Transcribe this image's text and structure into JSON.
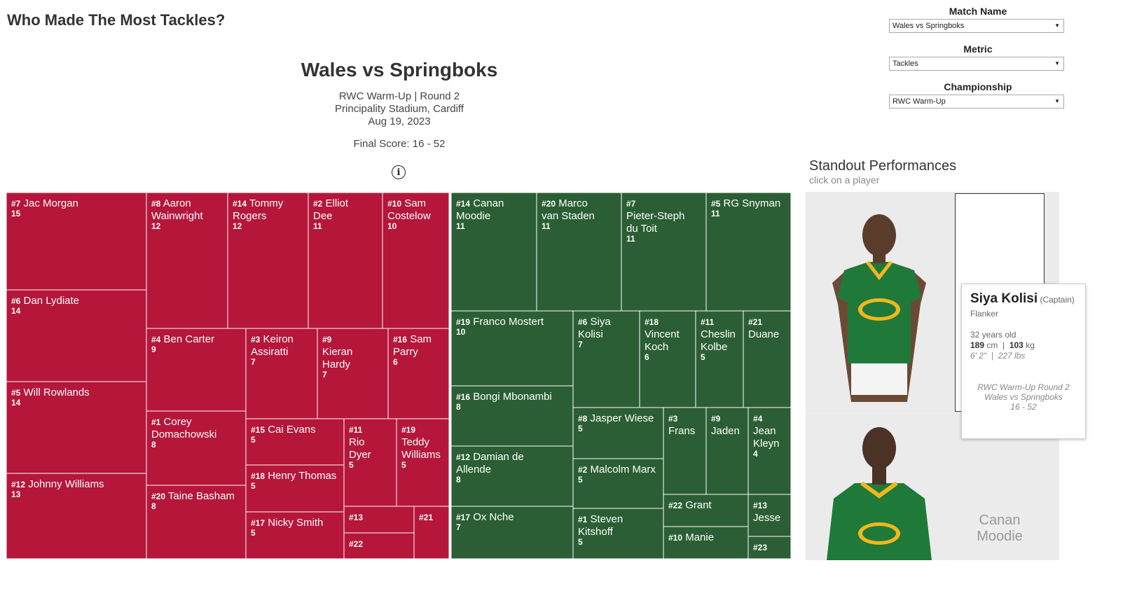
{
  "page": {
    "title": "Who Made The Most Tackles?"
  },
  "match": {
    "title": "Wales vs Springboks",
    "subtitle": "RWC Warm-Up | Round 2",
    "venue": "Principality Stadium, Cardiff",
    "date": "Aug 19, 2023",
    "final_score": "Final Score: 16 - 52",
    "info_glyph": "i"
  },
  "filters": {
    "match_name": {
      "label": "Match Name",
      "value": "Wales vs Springboks"
    },
    "metric": {
      "label": "Metric",
      "value": "Tackles"
    },
    "championship": {
      "label": "Championship",
      "value": "RWC Warm-Up"
    }
  },
  "standout": {
    "title": "Standout Performances",
    "subtitle": "click on a player",
    "second_name": "Canan Moodie"
  },
  "tooltip": {
    "name": "Siya Kolisi",
    "role": "(Captain)",
    "position": "Flanker",
    "age": "32 years old",
    "height_cm": "189",
    "weight_kg": "103",
    "height_imp": "6' 2\"",
    "weight_lbs": "227 lbs",
    "match_line1": "RWC Warm-Up Round 2",
    "match_line2": "Wales vs Springboks",
    "match_line3": "16 - 52"
  },
  "colors": {
    "wales": "#b5163a",
    "springboks": "#2b5e34",
    "tile_border": "#ffffff",
    "jersey_green": "#1f7a3a",
    "jersey_gold": "#f2b71d"
  },
  "icons": {
    "dropdown": "chevron-down-icon",
    "info": "info-icon"
  },
  "chart_data": {
    "type": "treemap",
    "metric": "Tackles",
    "teams": [
      {
        "name": "Wales",
        "players": [
          {
            "number": "#7",
            "name": "Jac Morgan",
            "value": 15
          },
          {
            "number": "#6",
            "name": "Dan Lydiate",
            "value": 14
          },
          {
            "number": "#5",
            "name": "Will Rowlands",
            "value": 14
          },
          {
            "number": "#12",
            "name": "Johnny Williams",
            "value": 13
          },
          {
            "number": "#8",
            "name": "Aaron Wainwright",
            "value": 12
          },
          {
            "number": "#14",
            "name": "Tommy Rogers",
            "value": 12
          },
          {
            "number": "#2",
            "name": "Elliot Dee",
            "value": 11
          },
          {
            "number": "#10",
            "name": "Sam Costelow",
            "value": 10
          },
          {
            "number": "#4",
            "name": "Ben Carter",
            "value": 9
          },
          {
            "number": "#1",
            "name": "Corey Domachowski",
            "value": 8
          },
          {
            "number": "#20",
            "name": "Taine Basham",
            "value": 8
          },
          {
            "number": "#3",
            "name": "Keiron Assiratti",
            "value": 7
          },
          {
            "number": "#9",
            "name": "Kieran Hardy",
            "value": 7
          },
          {
            "number": "#16",
            "name": "Sam Parry",
            "value": 6
          },
          {
            "number": "#15",
            "name": "Cai Evans",
            "value": 5
          },
          {
            "number": "#11",
            "name": "Rio Dyer",
            "value": 5
          },
          {
            "number": "#19",
            "name": "Teddy Williams",
            "value": 5
          },
          {
            "number": "#18",
            "name": "Henry Thomas",
            "value": 5
          },
          {
            "number": "#17",
            "name": "Nicky Smith",
            "value": 5
          },
          {
            "number": "#13",
            "name": "",
            "value": null
          },
          {
            "number": "#22",
            "name": "",
            "value": null
          },
          {
            "number": "#21",
            "name": "",
            "value": null
          }
        ]
      },
      {
        "name": "Springboks",
        "players": [
          {
            "number": "#14",
            "name": "Canan Moodie",
            "value": 11
          },
          {
            "number": "#20",
            "name": "Marco van Staden",
            "value": 11
          },
          {
            "number": "#7",
            "name": "Pieter-Steph du Toit",
            "value": 11
          },
          {
            "number": "#5",
            "name": "RG Snyman",
            "value": 11
          },
          {
            "number": "#19",
            "name": "Franco Mostert",
            "value": 10
          },
          {
            "number": "#6",
            "name": "Siya Kolisi",
            "value": 7
          },
          {
            "number": "#18",
            "name": "Vincent Koch",
            "value": 6
          },
          {
            "number": "#11",
            "name": "Cheslin Kolbe",
            "value": 5
          },
          {
            "number": "#21",
            "name": "Duane",
            "value": null
          },
          {
            "number": "#16",
            "name": "Bongi Mbonambi",
            "value": 8
          },
          {
            "number": "#8",
            "name": "Jasper Wiese",
            "value": 5
          },
          {
            "number": "#3",
            "name": "Frans",
            "value": null
          },
          {
            "number": "#9",
            "name": "Jaden",
            "value": null
          },
          {
            "number": "#4",
            "name": "Jean Kleyn",
            "value": 4
          },
          {
            "number": "#12",
            "name": "Damian de Allende",
            "value": 8
          },
          {
            "number": "#2",
            "name": "Malcolm Marx",
            "value": 5
          },
          {
            "number": "#17",
            "name": "Ox Nche",
            "value": 7
          },
          {
            "number": "#1",
            "name": "Steven Kitshoff",
            "value": 5
          },
          {
            "number": "#22",
            "name": "Grant",
            "value": null
          },
          {
            "number": "#13",
            "name": "Jesse",
            "value": null
          },
          {
            "number": "#10",
            "name": "Manie",
            "value": null
          },
          {
            "number": "#23",
            "name": "",
            "value": null
          }
        ]
      }
    ]
  }
}
